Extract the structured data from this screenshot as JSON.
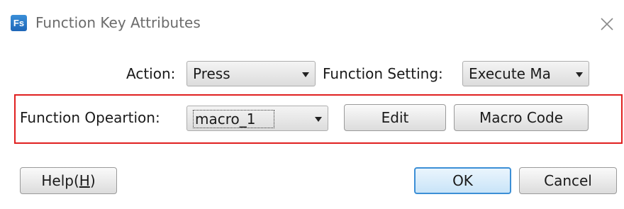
{
  "window": {
    "app_icon_text": "Fs",
    "title": "Function Key Attributes"
  },
  "form": {
    "action_label": "Action:",
    "action_value": "Press",
    "function_setting_label": "Function Setting:",
    "function_setting_value": "Execute Ma",
    "function_operation_label": "Function Opeartion:",
    "function_operation_value": "macro_1",
    "edit_button": "Edit",
    "macro_code_button": "Macro Code"
  },
  "footer": {
    "help_label": "Help(",
    "help_mnemonic": "H",
    "help_suffix": ")",
    "ok_button": "OK",
    "cancel_button": "Cancel"
  },
  "colors": {
    "highlight_border": "#e02020",
    "default_button_border": "#3c8fd6"
  }
}
